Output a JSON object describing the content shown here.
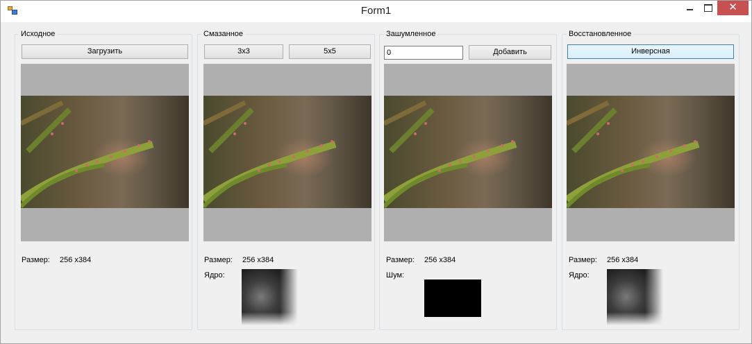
{
  "window": {
    "title": "Form1",
    "close_glyph": "✕",
    "icon": "winforms-app-icon"
  },
  "groups": {
    "original": {
      "title": "Исходное",
      "load_label": "Загрузить",
      "size_label": "Размер:",
      "size_value": "256 x384"
    },
    "blurred": {
      "title": "Смазанное",
      "btn3_label": "3x3",
      "btn5_label": "5x5",
      "size_label": "Размер:",
      "size_value": "256 x384",
      "kernel_label": "Ядро:"
    },
    "noisy": {
      "title": "Зашумленное",
      "noise_value": "0",
      "add_label": "Добавить",
      "size_label": "Размер:",
      "size_value": "256 x384",
      "noise_label": "Шум:"
    },
    "restored": {
      "title": "Восстановленное",
      "inverse_label": "Инверсная",
      "size_label": "Размер:",
      "size_value": "256 x384",
      "kernel_label": "Ядро:"
    }
  },
  "colors": {
    "picturebox_bg": "#afafaf",
    "window_bg": "#f0f0f0",
    "close_bg": "#c75050"
  }
}
